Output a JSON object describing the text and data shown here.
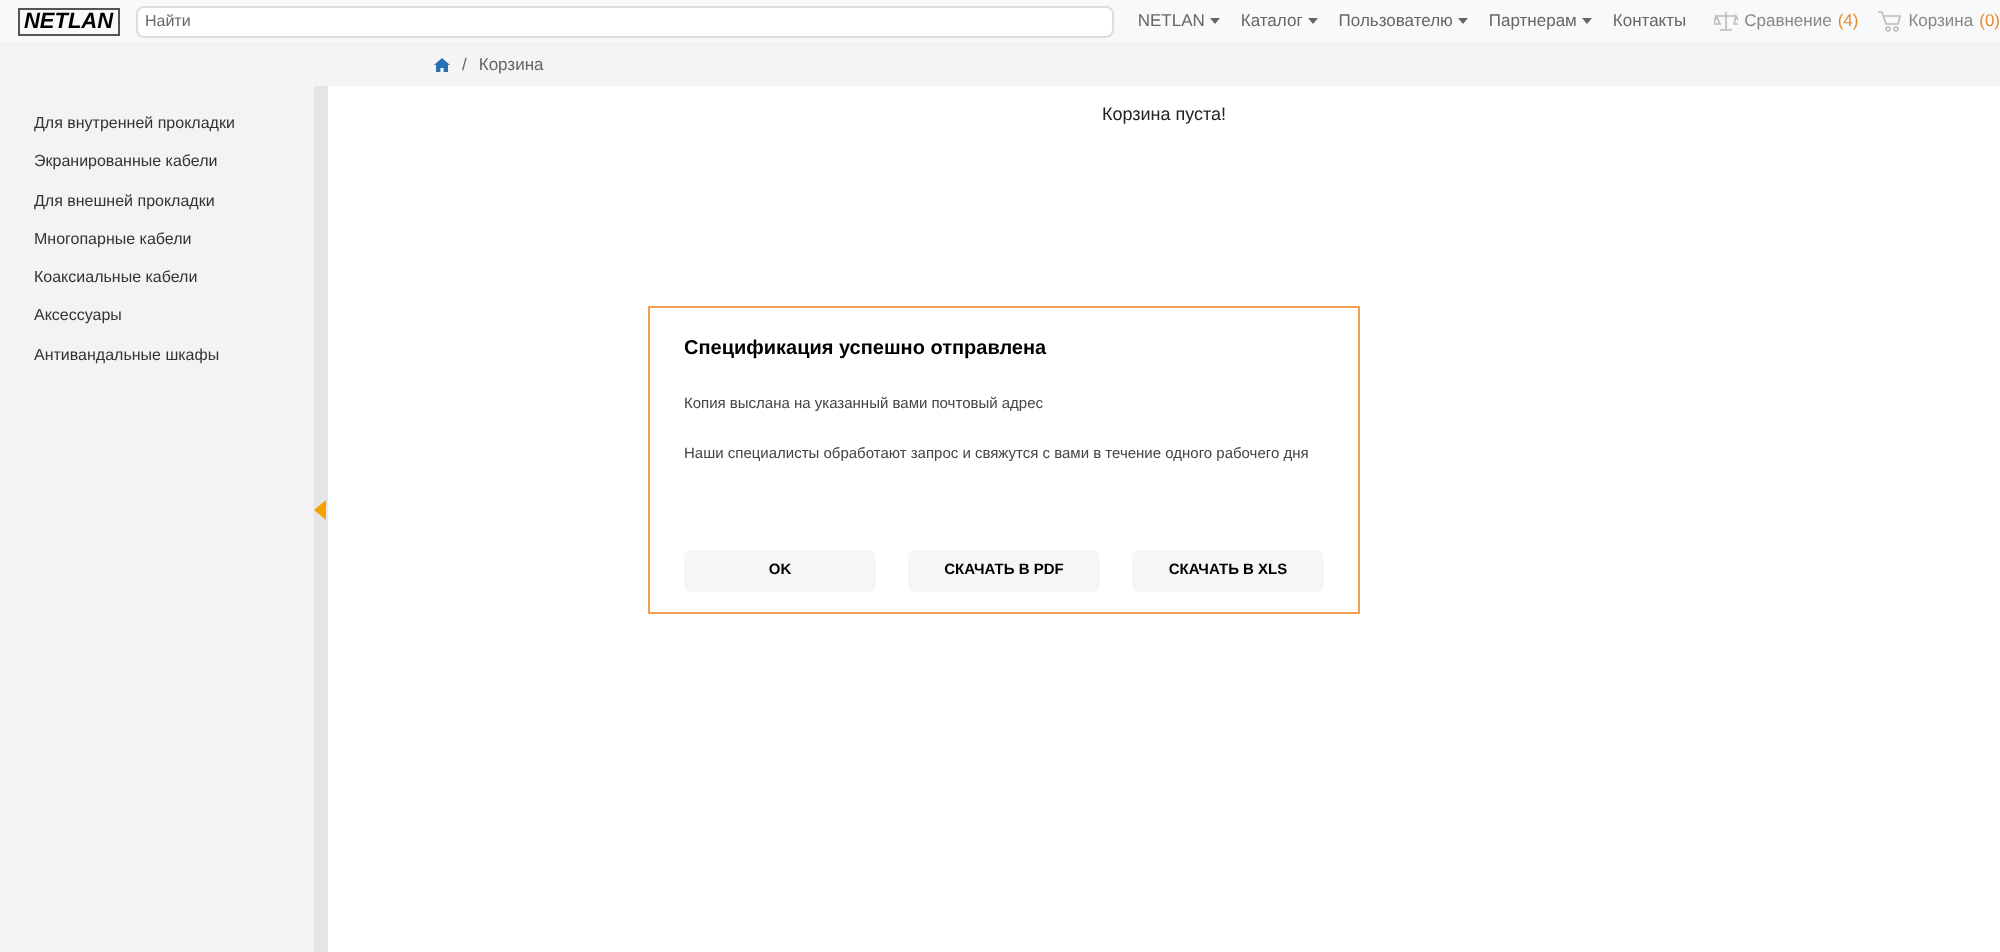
{
  "logo": "NETLAN",
  "search": {
    "placeholder": "Найти"
  },
  "nav": [
    {
      "label": "NETLAN",
      "dropdown": true
    },
    {
      "label": "Каталог",
      "dropdown": true
    },
    {
      "label": "Пользователю",
      "dropdown": true
    },
    {
      "label": "Партнерам",
      "dropdown": true
    },
    {
      "label": "Контакты",
      "dropdown": false
    }
  ],
  "compare": {
    "label": "Сравнение",
    "count": "(4)"
  },
  "cart": {
    "label": "Корзина",
    "count": "(0)"
  },
  "breadcrumb_separator": "/",
  "breadcrumb": [
    "Корзина"
  ],
  "sidebar": {
    "items": [
      "Для внутренней прокладки",
      "Экранированные кабели",
      "Для внешней прокладки",
      "Многопарные кабели",
      "Коаксиальные кабели",
      "Аксессуары",
      "Антивандальные шкафы"
    ]
  },
  "main": {
    "message": "Корзина пуста!"
  },
  "dialog": {
    "title": "Спецификация успешно отправлена",
    "lines": [
      "Копия выслана на указанный вами почтовый адрес",
      "Наши специалисты обработают запрос и свяжутся с вами в течение одного рабочего дня"
    ],
    "buttons": [
      "OK",
      "СКАЧАТЬ В PDF",
      "СКАЧАТЬ В XLS"
    ]
  }
}
